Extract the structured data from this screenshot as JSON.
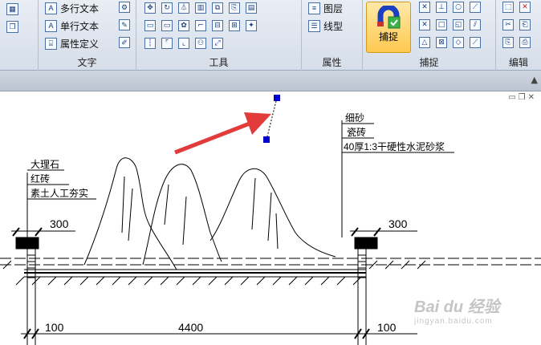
{
  "ribbon": {
    "text_group": {
      "label": "文字",
      "mtext": "多行文本",
      "stext": "单行文本",
      "attdef": "属性定义"
    },
    "tools_group": {
      "label": "工具"
    },
    "props_group": {
      "label": "属性",
      "layers": "图层",
      "linetype": "线型"
    },
    "snap_group": {
      "label": "捕捉",
      "snap_button": "捕捉"
    },
    "edit_group": {
      "label": "编辑"
    }
  },
  "drawing": {
    "left_layers": [
      "大理石",
      "红砖",
      "素土人工夯实"
    ],
    "right_layers": [
      "细砂",
      "瓷砖",
      "40厚1:3干硬性水泥砂浆"
    ],
    "dims": {
      "left_cap": "300",
      "right_cap": "300",
      "bottom_left": "100",
      "bottom_mid": "4400",
      "bottom_right": "100"
    }
  },
  "watermark": {
    "main": "Bai du 经验",
    "sub": "jingyan.baidu.com"
  },
  "colors": {
    "arrow": "#e23b3b",
    "grip": "#0000cc",
    "snap_active": "#ffc94f"
  }
}
